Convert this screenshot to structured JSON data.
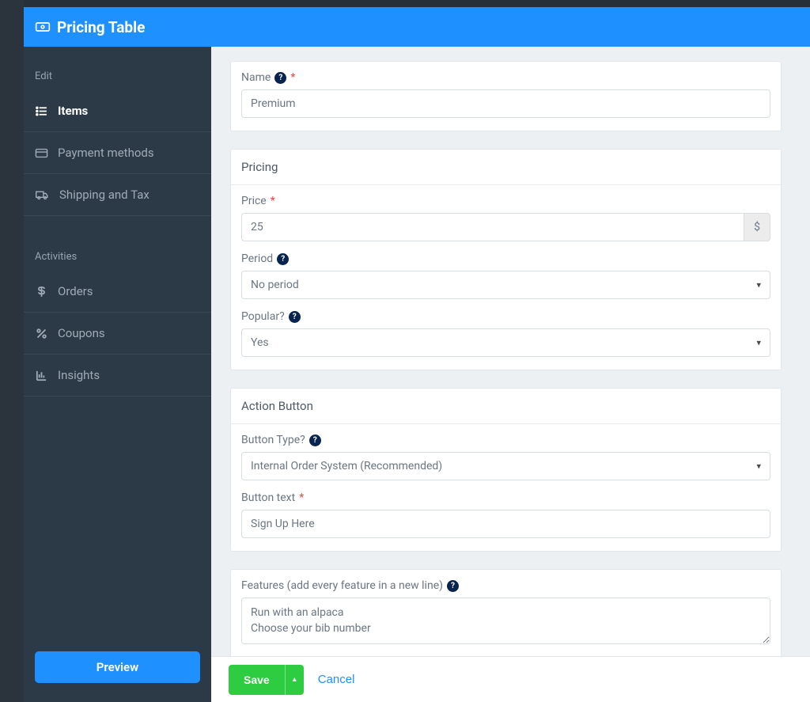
{
  "header": {
    "title": "Pricing Table"
  },
  "sidebar": {
    "section_edit": "Edit",
    "section_activities": "Activities",
    "items": {
      "items": "Items",
      "payment": "Payment methods",
      "shipping": "Shipping and Tax",
      "orders": "Orders",
      "coupons": "Coupons",
      "insights": "Insights"
    },
    "preview": "Preview"
  },
  "form": {
    "name": {
      "label": "Name",
      "value": "Premium"
    },
    "pricing_header": "Pricing",
    "price": {
      "label": "Price",
      "value": "25",
      "currency": "$"
    },
    "period": {
      "label": "Period",
      "value": "No period"
    },
    "popular": {
      "label": "Popular?",
      "value": "Yes"
    },
    "action_header": "Action Button",
    "button_type": {
      "label": "Button Type?",
      "value": "Internal Order System (Recommended)"
    },
    "button_text": {
      "label": "Button text",
      "value": "Sign Up Here"
    },
    "features": {
      "label": "Features (add every feature in a new line)",
      "value": "Run with an alpaca\nChoose your bib number"
    }
  },
  "footer": {
    "save": "Save",
    "cancel": "Cancel"
  }
}
